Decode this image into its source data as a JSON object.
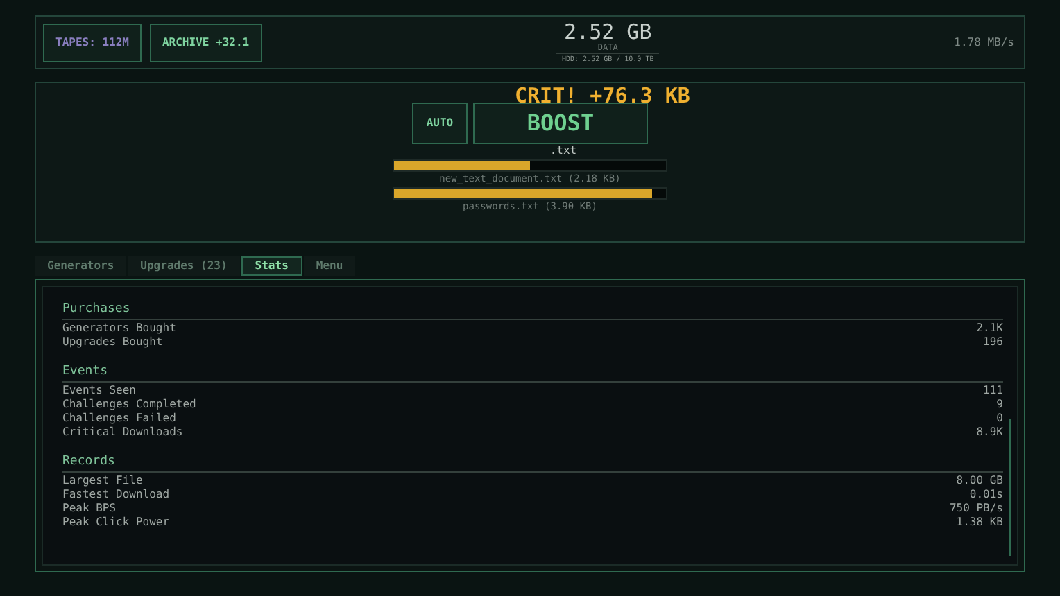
{
  "header": {
    "tapes_button": "TAPES: 112M",
    "archive_button": "ARCHIVE +32.1",
    "data_amount": "2.52 GB",
    "data_label": "DATA",
    "storage": "HDD: 2.52 GB / 10.0 TB",
    "rate": "1.78 MB/s"
  },
  "clicker": {
    "crit_text": "CRIT! +76.3 KB",
    "auto_button": "AUTO",
    "boost_button": "BOOST",
    "particle": ".txt",
    "downloads": [
      {
        "name": "new_text_document.txt (2.18 KB)",
        "level": 0.5
      },
      {
        "name": "passwords.txt (3.90 KB)",
        "level": 0.95
      }
    ]
  },
  "tabs": [
    {
      "label": "Generators",
      "selected": false
    },
    {
      "label": "Upgrades (23)",
      "selected": false
    },
    {
      "label": "Stats",
      "selected": true
    },
    {
      "label": "Menu",
      "selected": false
    }
  ],
  "sections": [
    {
      "title": "Purchases",
      "rows": [
        {
          "label": "Generators Bought",
          "value": "2.1K"
        },
        {
          "label": "Upgrades Bought",
          "value": "196"
        }
      ]
    },
    {
      "title": "Events",
      "rows": [
        {
          "label": "Events Seen",
          "value": "111"
        },
        {
          "label": "Challenges Completed",
          "value": "9"
        },
        {
          "label": "Challenges Failed",
          "value": "0"
        },
        {
          "label": "Critical Downloads",
          "value": "8.9K"
        }
      ]
    },
    {
      "title": "Records",
      "rows": [
        {
          "label": "Largest File",
          "value": "8.00 GB"
        },
        {
          "label": "Fastest Download",
          "value": "0.01s"
        },
        {
          "label": "Peak BPS",
          "value": "750 PB/s"
        },
        {
          "label": "Peak Click Power",
          "value": "1.38 KB"
        }
      ]
    }
  ]
}
